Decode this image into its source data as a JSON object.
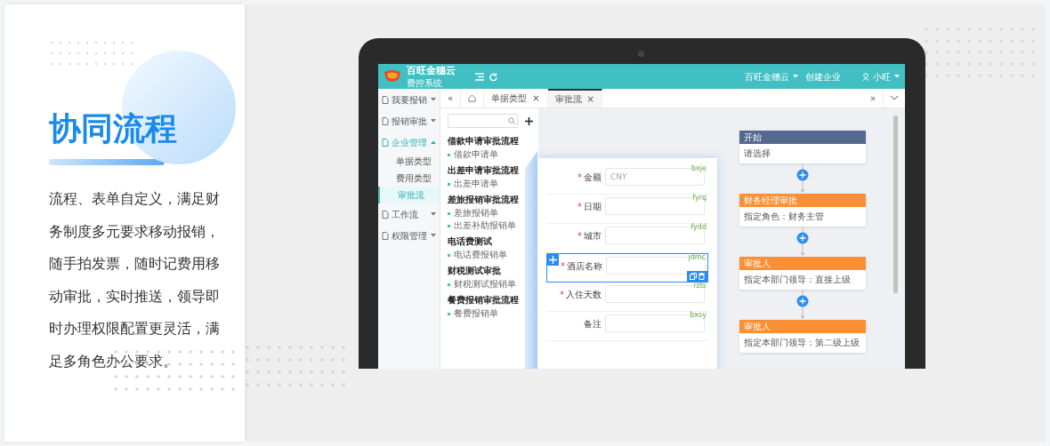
{
  "feature": {
    "title": "协同流程",
    "description": "流程、表单自定义，满足财务制度多元要求移动报销，随手拍发票，随时记费用移动审批，实时推送，领导即时办理权限配置更灵活，满足多角色办公要求。"
  },
  "app": {
    "brand": {
      "name": "百旺金穗云",
      "subtitle": "费控系统"
    },
    "header_menu": [
      {
        "kind": "menu",
        "label": "百旺金穗云"
      },
      {
        "kind": "link",
        "label": "创建企业"
      },
      {
        "kind": "user",
        "label": "小旺"
      }
    ],
    "sidebar": [
      {
        "label": "我要报销",
        "expanded": false,
        "selected": false
      },
      {
        "label": "报销审批",
        "expanded": false,
        "selected": false
      },
      {
        "label": "企业管理",
        "expanded": true,
        "selected": true,
        "children": [
          {
            "label": "单据类型",
            "selected": false
          },
          {
            "label": "费用类型",
            "selected": false
          },
          {
            "label": "审批流",
            "selected": true
          }
        ]
      },
      {
        "label": "工作流",
        "expanded": false,
        "selected": false
      },
      {
        "label": "权限管理",
        "expanded": false,
        "selected": false
      }
    ],
    "tab_nav": {
      "back": "«",
      "forward": "»"
    },
    "tabs": [
      {
        "label": "单据类型",
        "close": "×",
        "selected": false
      },
      {
        "label": "审批流",
        "close": "×",
        "selected": true
      }
    ],
    "flow_list": [
      {
        "title": "借款申请审批流程",
        "forms": [
          "借款申请单"
        ]
      },
      {
        "title": "出差申请审批流程",
        "forms": [
          "出差申请单"
        ]
      },
      {
        "title": "差旅报销审批流程",
        "forms": [
          "差旅报销单",
          "出差补助报销单"
        ]
      },
      {
        "title": "电话费测试",
        "forms": [
          "电话费报销单"
        ]
      },
      {
        "title": "财税测试审批",
        "forms": [
          "财税测试报销单"
        ]
      },
      {
        "title": "餐费报销审批流程",
        "forms": [
          "餐费报销单"
        ]
      }
    ],
    "form_fields": [
      {
        "label": "金额",
        "required_mark": "*",
        "placeholder": "CNY",
        "code": "bxje",
        "selected": false
      },
      {
        "label": "日期",
        "required_mark": "*",
        "code": "fyrq",
        "selected": false
      },
      {
        "label": "城市",
        "required_mark": "*",
        "code": "fydd",
        "selected": false
      },
      {
        "label": "酒店名称",
        "required_mark": "*",
        "code": "jdmc",
        "selected": true
      },
      {
        "label": "入住天数",
        "required_mark": "*",
        "code": "rzts",
        "selected": false
      },
      {
        "label": "备注",
        "code": "bxsy",
        "selected": false
      }
    ],
    "flow_nodes": [
      {
        "kind": "start",
        "title": "开始",
        "text": "请选择"
      },
      {
        "kind": "approver",
        "title": "财务经理审批",
        "text": "指定角色：财务主管"
      },
      {
        "kind": "approver",
        "title": "审批人",
        "text": "指定本部门领导：直接上级"
      },
      {
        "kind": "approver",
        "title": "审批人",
        "text": "指定本部门领导：第二级上级"
      }
    ]
  }
}
